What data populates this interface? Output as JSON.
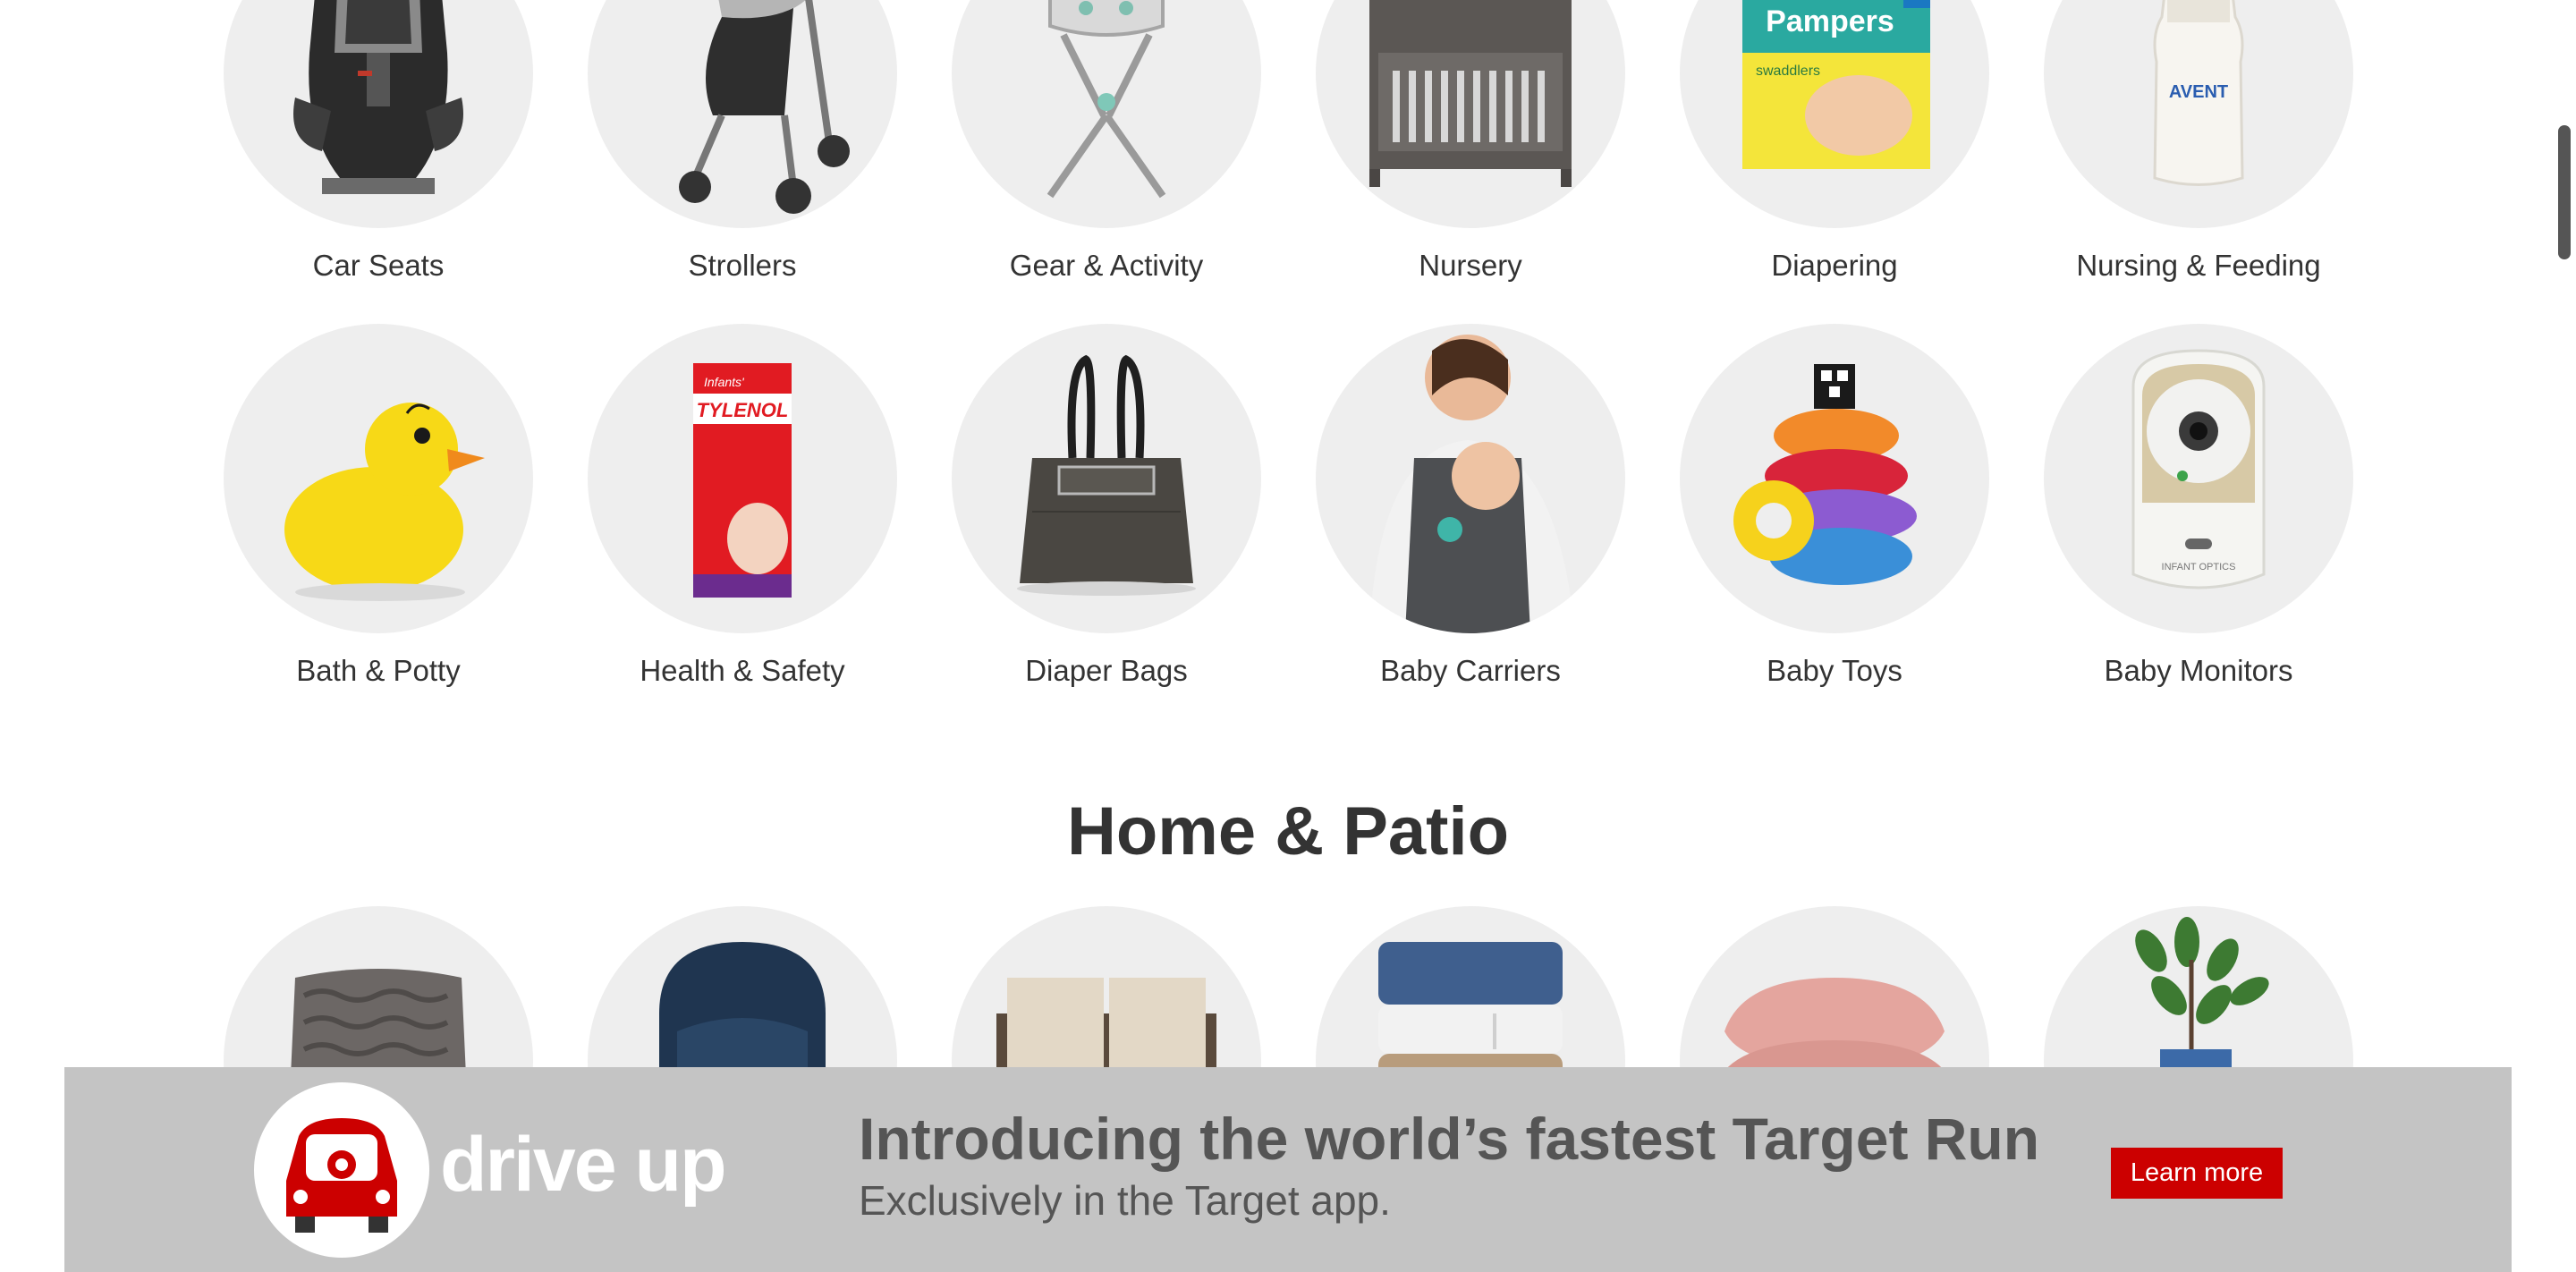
{
  "categories_row1": [
    {
      "label": "Car Seats",
      "icon": "car-seat-image"
    },
    {
      "label": "Strollers",
      "icon": "stroller-image"
    },
    {
      "label": "Gear & Activity",
      "icon": "bouncer-image"
    },
    {
      "label": "Nursery",
      "icon": "crib-image"
    },
    {
      "label": "Diapering",
      "icon": "diapers-image"
    },
    {
      "label": "Nursing & Feeding",
      "icon": "bottle-image"
    }
  ],
  "categories_row2": [
    {
      "label": "Bath & Potty",
      "icon": "rubber-duck-image"
    },
    {
      "label": "Health & Safety",
      "icon": "medicine-box-image"
    },
    {
      "label": "Diaper Bags",
      "icon": "diaper-bag-image"
    },
    {
      "label": "Baby Carriers",
      "icon": "baby-carrier-image"
    },
    {
      "label": "Baby Toys",
      "icon": "stacking-rings-image"
    },
    {
      "label": "Baby Monitors",
      "icon": "baby-monitor-image"
    }
  ],
  "product_text": {
    "pampers": "Pampers",
    "swaddlers": "swaddlers",
    "avent": "AVENT",
    "tylenol": "TYLENOL",
    "infants": "Infants'",
    "infant_optics": "INFANT OPTICS"
  },
  "home_section": {
    "title": "Home & Patio",
    "items": [
      "knit-pillow-image",
      "armchair-image",
      "loveseat-image",
      "towels-image",
      "pillows-image",
      "plant-image"
    ]
  },
  "banner": {
    "logo_text": "drive up",
    "headline": "Introducing the world’s fastest Target Run",
    "subline": "Exclusively in the Target app.",
    "button": "Learn more",
    "accent": "#cc0000",
    "background": "#c4c4c4"
  }
}
